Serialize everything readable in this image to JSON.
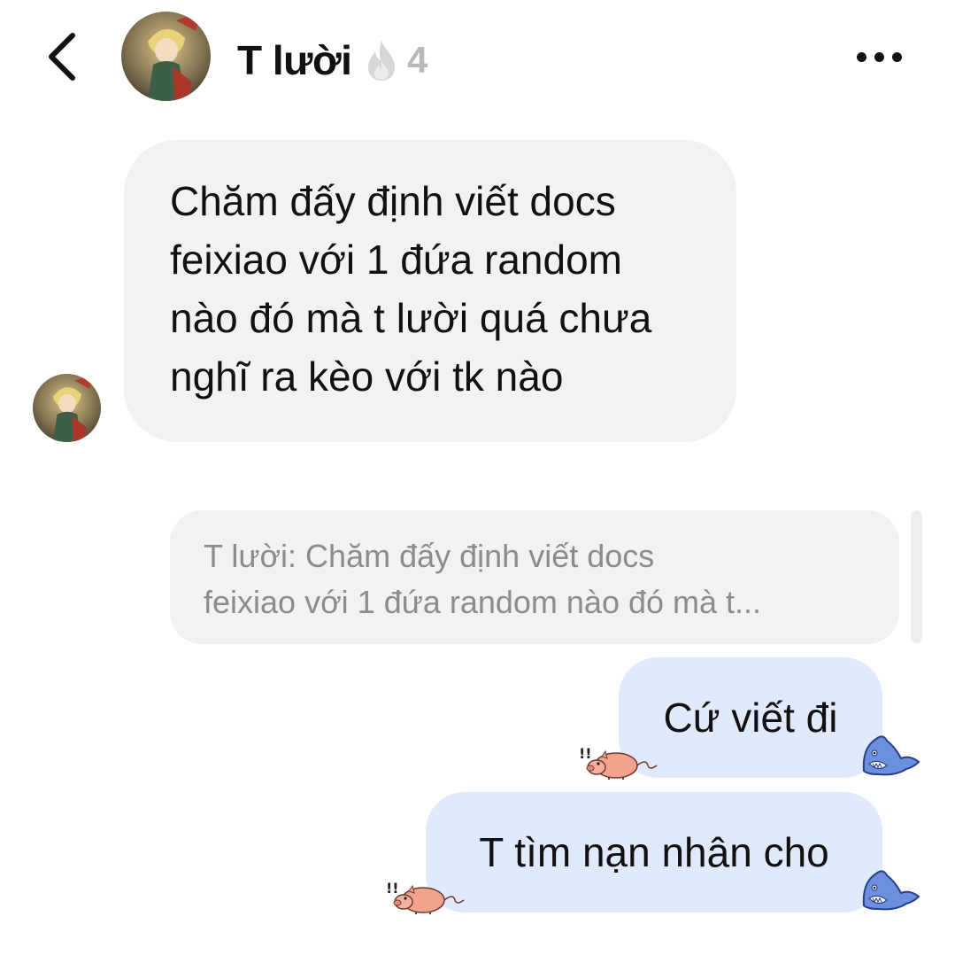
{
  "header": {
    "back_icon": "chevron-left-icon",
    "contact_name": "T lười",
    "streak_icon": "flame-icon",
    "streak_count": "4",
    "more_icon": "more-horizontal-icon"
  },
  "messages": {
    "incoming_text": "Chăm đấy định viết docs feixiao với 1 đứa random nào đó mà t lười quá chưa nghĩ ra kèo với tk nào",
    "incoming_lines": [
      "Chăm đấy định viết docs",
      "feixiao với 1 đứa random",
      "nào đó mà t lười quá chưa",
      "nghĩ ra kèo với tk nào"
    ],
    "reply_preview": {
      "line1": "T lười: Chăm đấy định viết docs",
      "line2": "feixiao với 1 đứa random nào đó mà t..."
    },
    "outgoing": [
      {
        "text": "Cứ viết đi"
      },
      {
        "text": "T tìm nạn nhân cho"
      }
    ]
  },
  "stickers": {
    "pig": "pig-sticker-icon",
    "shark": "blue-shark-sticker-icon"
  },
  "colors": {
    "incoming_bubble": "#f2f2f2",
    "outgoing_bubble": "#e1e9fd",
    "muted_text": "#8c8c8c",
    "streak_gray": "#b9b9b9"
  }
}
